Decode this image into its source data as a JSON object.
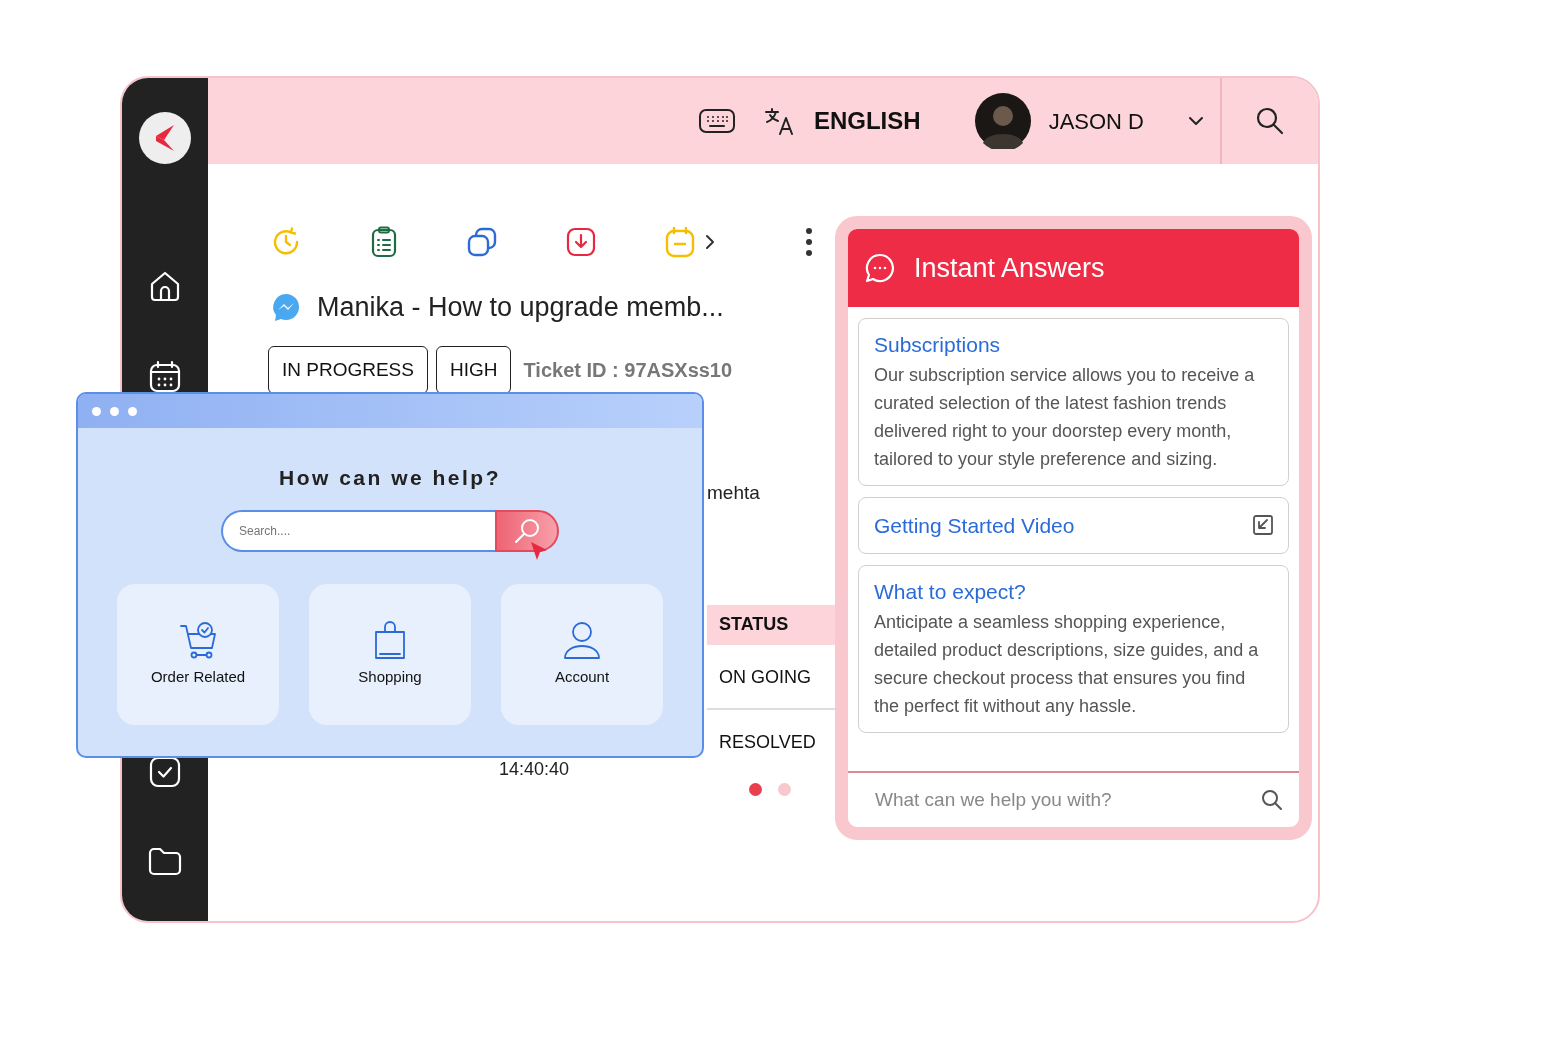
{
  "header": {
    "language": "ENGLISH",
    "user": "JASON D"
  },
  "ticket": {
    "title": "Manika - How to upgrade memb...",
    "tags": [
      "IN PROGRESS",
      "HIGH"
    ],
    "ticket_id": "Ticket ID : 97ASXss10"
  },
  "background_fragments": {
    "name_fragment": "mehta",
    "time": "14:40:40"
  },
  "status_column": {
    "header": "STATUS",
    "rows": [
      "ON GOING",
      "RESOLVED"
    ]
  },
  "pager": {
    "dots": [
      {
        "selected": true
      },
      {
        "selected": false
      }
    ]
  },
  "help_window": {
    "title": "How can we help?",
    "search": {
      "placeholder": "Search...."
    },
    "categories": [
      {
        "label": "Order Related",
        "kind": "cart"
      },
      {
        "label": "Shopping",
        "kind": "bag"
      },
      {
        "label": "Account",
        "kind": "user"
      }
    ]
  },
  "instant_answers": {
    "title": "Instant Answers",
    "articles": [
      {
        "kind": "article",
        "title": "Subscriptions",
        "body": "Our subscription service allows you to receive a curated selection of the latest fashion trends delivered right to your doorstep every month, tailored to your style preference and sizing."
      },
      {
        "kind": "link",
        "title": "Getting Started Video"
      },
      {
        "kind": "article",
        "title": "What to expect?",
        "body": "Anticipate a seamless shopping experience, detailed product descriptions, size guides, and a secure checkout process that ensures you find the perfect fit without any hassle."
      }
    ],
    "search": {
      "placeholder": "What can we help you with?"
    }
  }
}
